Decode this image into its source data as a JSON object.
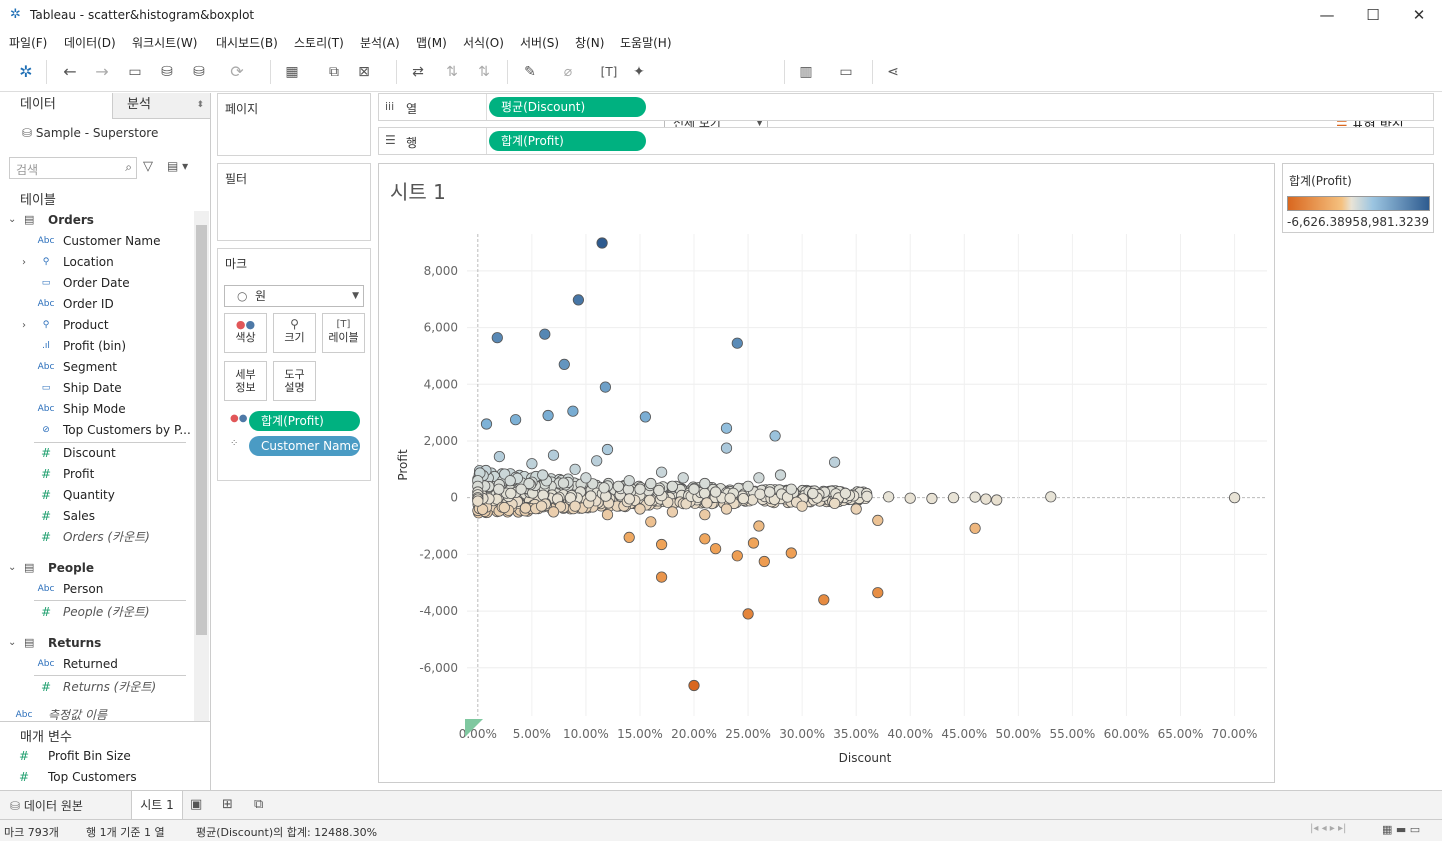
{
  "window": {
    "title": "Tableau - scatter&histogram&boxplot"
  },
  "menu": [
    "파일(F)",
    "데이터(D)",
    "워크시트(W)",
    "대시보드(B)",
    "스토리(T)",
    "분석(A)",
    "맵(M)",
    "서식(O)",
    "서버(S)",
    "창(N)",
    "도움말(H)"
  ],
  "toolbar": {
    "view_select": "전체 보기",
    "show_me": "표현 방식"
  },
  "left": {
    "tab_data": "데이터",
    "tab_analysis": "분석",
    "datasource": "Sample - Superstore",
    "search_placeholder": "검색",
    "tables_header": "테이블",
    "orders": "Orders",
    "order_fields": [
      "Customer Name",
      "Location",
      "Order Date",
      "Order ID",
      "Product",
      "Profit (bin)",
      "Segment",
      "Ship Date",
      "Ship Mode",
      "Top Customers by P..."
    ],
    "order_measures": [
      "Discount",
      "Profit",
      "Quantity",
      "Sales",
      "Orders (카운트)"
    ],
    "people": "People",
    "people_fields": [
      "Person",
      "People (카운트)"
    ],
    "returns": "Returns",
    "returns_fields": [
      "Returned",
      "Returns (카운트)"
    ],
    "measure_names": "측정값 이름",
    "params_header": "매개 변수",
    "params": [
      "Profit Bin Size",
      "Top Customers"
    ]
  },
  "shelves": {
    "pages": "페이지",
    "filters": "필터",
    "marks": "마크",
    "mark_type": "원",
    "mark_buttons": [
      "색상",
      "크기",
      "레이블",
      "세부\n정보",
      "도구\n설명"
    ],
    "mark_pills": [
      "합계(Profit)",
      "Customer Name"
    ],
    "columns_label": "열",
    "rows_label": "행",
    "columns_pill": "평균(Discount)",
    "rows_pill": "합계(Profit)"
  },
  "sheet": {
    "title": "시트 1"
  },
  "legend": {
    "title": "합계(Profit)",
    "min": "-6,626.3895",
    "max": "8,981.3239"
  },
  "colors": {
    "neg": "#d9671f",
    "mid": "#e8e3d6",
    "pos": "#2e5b8f",
    "pill_green": "#00b180",
    "pill_blue": "#4a9bc4"
  },
  "chart_data": {
    "type": "scatter",
    "xlabel": "Discount",
    "ylabel": "Profit",
    "xlim": [
      -0.01,
      0.73
    ],
    "ylim": [
      -7700,
      9300
    ],
    "x_ticks": [
      "0.00%",
      "5.00%",
      "10.00%",
      "15.00%",
      "20.00%",
      "25.00%",
      "30.00%",
      "35.00%",
      "40.00%",
      "45.00%",
      "50.00%",
      "55.00%",
      "60.00%",
      "65.00%",
      "70.00%"
    ],
    "y_ticks": [
      "8,000",
      "6,000",
      "4,000",
      "2,000",
      "0",
      "-2,000",
      "-4,000",
      "-6,000"
    ],
    "point_count": 793,
    "points": [
      [
        0.115,
        8981
      ],
      [
        0.093,
        6976
      ],
      [
        0.018,
        5644
      ],
      [
        0.062,
        5765
      ],
      [
        0.24,
        5450
      ],
      [
        0.08,
        4700
      ],
      [
        0.118,
        3900
      ],
      [
        0.008,
        2600
      ],
      [
        0.155,
        2850
      ],
      [
        0.088,
        3050
      ],
      [
        0.275,
        2180
      ],
      [
        0.035,
        2750
      ],
      [
        0.065,
        2900
      ],
      [
        0.23,
        2450
      ],
      [
        0.33,
        1250
      ],
      [
        0.23,
        1750
      ],
      [
        0.28,
        800
      ],
      [
        0.26,
        700
      ],
      [
        0.02,
        1450
      ],
      [
        0.05,
        1200
      ],
      [
        0.12,
        1700
      ],
      [
        0.17,
        900
      ],
      [
        0.04,
        300
      ],
      [
        0.03,
        600
      ],
      [
        0.06,
        800
      ],
      [
        0.07,
        1500
      ],
      [
        0.09,
        1000
      ],
      [
        0.1,
        700
      ],
      [
        0.11,
        1300
      ],
      [
        0.13,
        400
      ],
      [
        0.14,
        600
      ],
      [
        0.15,
        300
      ],
      [
        0.16,
        500
      ],
      [
        0.18,
        400
      ],
      [
        0.19,
        700
      ],
      [
        0.2,
        300
      ],
      [
        0.21,
        500
      ],
      [
        0.22,
        200
      ],
      [
        0.25,
        400
      ],
      [
        0.27,
        200
      ],
      [
        0.29,
        300
      ],
      [
        0.31,
        150
      ],
      [
        0.34,
        150
      ],
      [
        0.36,
        50
      ],
      [
        0.38,
        30
      ],
      [
        0.4,
        -20
      ],
      [
        0.44,
        0
      ],
      [
        0.46,
        20
      ],
      [
        0.47,
        -50
      ],
      [
        0.48,
        -80
      ],
      [
        0.53,
        30
      ],
      [
        0.7,
        0
      ],
      [
        0.46,
        -1080
      ],
      [
        0.37,
        -3350
      ],
      [
        0.32,
        -3600
      ],
      [
        0.25,
        -4100
      ],
      [
        0.2,
        -6626
      ],
      [
        0.17,
        -2800
      ],
      [
        0.24,
        -2050
      ],
      [
        0.265,
        -2250
      ],
      [
        0.17,
        -1650
      ],
      [
        0.21,
        -1450
      ],
      [
        0.14,
        -1400
      ],
      [
        0.22,
        -1800
      ],
      [
        0.255,
        -1600
      ],
      [
        0.26,
        -1000
      ],
      [
        0.29,
        -1950
      ],
      [
        0.16,
        -850
      ],
      [
        0.21,
        -600
      ],
      [
        0.23,
        -400
      ],
      [
        0.07,
        -500
      ],
      [
        0.09,
        -300
      ],
      [
        0.12,
        -600
      ],
      [
        0.15,
        -400
      ],
      [
        0.18,
        -500
      ],
      [
        0.35,
        -400
      ],
      [
        0.37,
        -800
      ],
      [
        0.0,
        600
      ],
      [
        0.0,
        400
      ],
      [
        0.0,
        200
      ],
      [
        0.0,
        100
      ],
      [
        0.0,
        0
      ],
      [
        0.0,
        -50
      ],
      [
        0.0,
        -120
      ],
      [
        0.3,
        -300
      ],
      [
        0.33,
        -200
      ],
      [
        0.42,
        -30
      ]
    ]
  },
  "tabs": {
    "datasource": "데이터 원본",
    "sheet": "시트 1"
  },
  "status": {
    "marks": "마크 793개",
    "rows": "행 1개 기준 1 열",
    "sum": "평균(Discount)의 합계: 12488.30%"
  }
}
